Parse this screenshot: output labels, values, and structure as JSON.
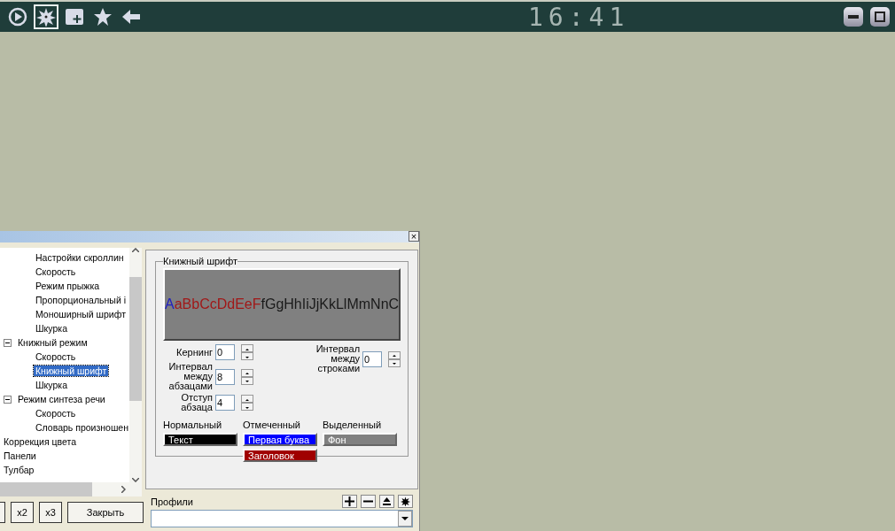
{
  "toolbar": {
    "buttons": [
      {
        "kind": "play",
        "selected": false
      },
      {
        "kind": "gear",
        "selected": true
      },
      {
        "kind": "add",
        "selected": false
      },
      {
        "kind": "star",
        "selected": false
      },
      {
        "kind": "back",
        "selected": false
      }
    ],
    "clock": "16:41",
    "window_buttons": [
      {
        "kind": "minimize"
      },
      {
        "kind": "maximize"
      }
    ]
  },
  "dialog": {
    "close": "×",
    "tree": [
      {
        "children": [
          {
            "children": [
              {
                "label": "Настройки скроллин",
                "selected": false
              },
              {
                "label": "Скорость",
                "selected": false
              },
              {
                "label": "Режим прыжка",
                "selected": false
              },
              {
                "label": "Пропорциональный і",
                "selected": false
              },
              {
                "label": "Моноширный шрифт",
                "selected": false
              },
              {
                "label": "Шкурка",
                "selected": false
              }
            ]
          },
          {
            "label": "Книжный режим",
            "selected": false,
            "expanded": true,
            "children": [
              {
                "label": "Скорость",
                "selected": false
              },
              {
                "label": "Книжный шрифт",
                "selected": true
              },
              {
                "label": "Шкурка",
                "selected": false
              }
            ]
          },
          {
            "label": "Режим синтеза речи",
            "selected": false,
            "expanded": true,
            "children": [
              {
                "label": "Скорость",
                "selected": false
              },
              {
                "label": "Словарь произношен",
                "selected": false
              }
            ]
          }
        ]
      },
      {
        "label": "Коррекция цвета",
        "selected": false
      },
      {
        "label": "Панели",
        "selected": false
      },
      {
        "label": "Тулбар",
        "selected": false
      }
    ],
    "buttons": [
      "x2",
      "x3",
      "Закрыть"
    ],
    "group": {
      "title": "Книжный шрифт",
      "preview": [
        {
          "text": "A",
          "color": "#2020c0"
        },
        {
          "text": "aBbCcDdEeF",
          "color": "#a01818"
        },
        {
          "text": "fGgHhIiJjKkLlMmNnC",
          "color": "#1a1a1a"
        }
      ],
      "spinners_left": [
        {
          "label": "Кернинг",
          "value": "0"
        },
        {
          "label": "Интервал между абзацами",
          "value": "8"
        },
        {
          "label": "Отступ абзаца",
          "value": "4"
        }
      ],
      "spinner_right": {
        "label": "Интервал между строками",
        "value": "0"
      },
      "color_columns": [
        {
          "header": "Нормальный",
          "swatches": [
            {
              "label": "Текст",
              "color": "#000000"
            }
          ]
        },
        {
          "header": "Отмеченный",
          "swatches": [
            {
              "label": "Первая буква",
              "color": "#0000ff"
            },
            {
              "label": "Заголовок",
              "color": "#a00000"
            }
          ]
        },
        {
          "header": "Выделенный",
          "swatches": [
            {
              "label": "Фон",
              "color": "#808080"
            }
          ]
        }
      ]
    },
    "profiles": {
      "label": "Профили",
      "buttons": [
        {
          "kind": "plus"
        },
        {
          "kind": "minus"
        },
        {
          "kind": "eject"
        },
        {
          "kind": "gear"
        }
      ]
    }
  }
}
